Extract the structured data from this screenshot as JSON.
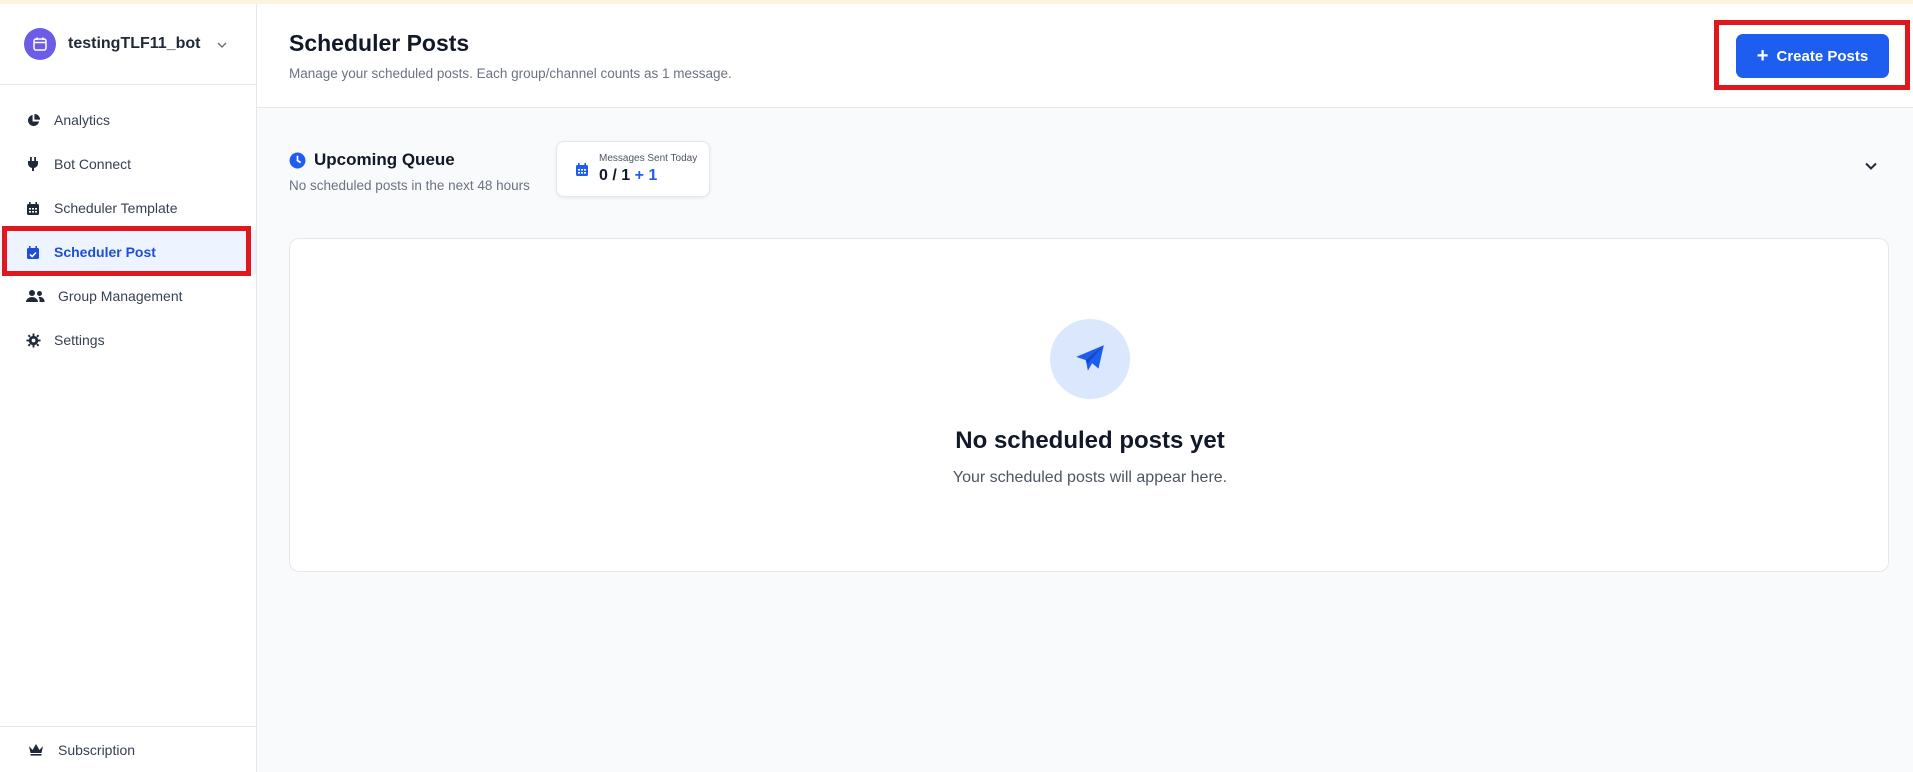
{
  "sidebar": {
    "bot_name": "testingTLF11_bot",
    "nav_items": [
      {
        "label": "Analytics",
        "icon": "pie-chart-icon"
      },
      {
        "label": "Bot Connect",
        "icon": "plug-icon"
      },
      {
        "label": "Scheduler Template",
        "icon": "calendar-grid-icon"
      },
      {
        "label": "Scheduler Post",
        "icon": "calendar-check-icon",
        "active": true
      },
      {
        "label": "Group Management",
        "icon": "users-icon"
      },
      {
        "label": "Settings",
        "icon": "gear-icon"
      }
    ],
    "subscription_label": "Subscription"
  },
  "header": {
    "title": "Scheduler Posts",
    "subtitle": "Manage your scheduled posts. Each group/channel counts as 1 message.",
    "create_button_label": "Create Posts"
  },
  "queue": {
    "title": "Upcoming Queue",
    "subtitle": "No scheduled posts in the next 48 hours",
    "messages_label": "Messages Sent Today",
    "messages_value": "0 / 1",
    "messages_extra": "+ 1"
  },
  "empty_state": {
    "title": "No scheduled posts yet",
    "subtitle": "Your scheduled posts will appear here."
  },
  "colors": {
    "accent": "#1d5ef0",
    "highlight": "#e0181e",
    "avatar": "#6d5ce8"
  }
}
